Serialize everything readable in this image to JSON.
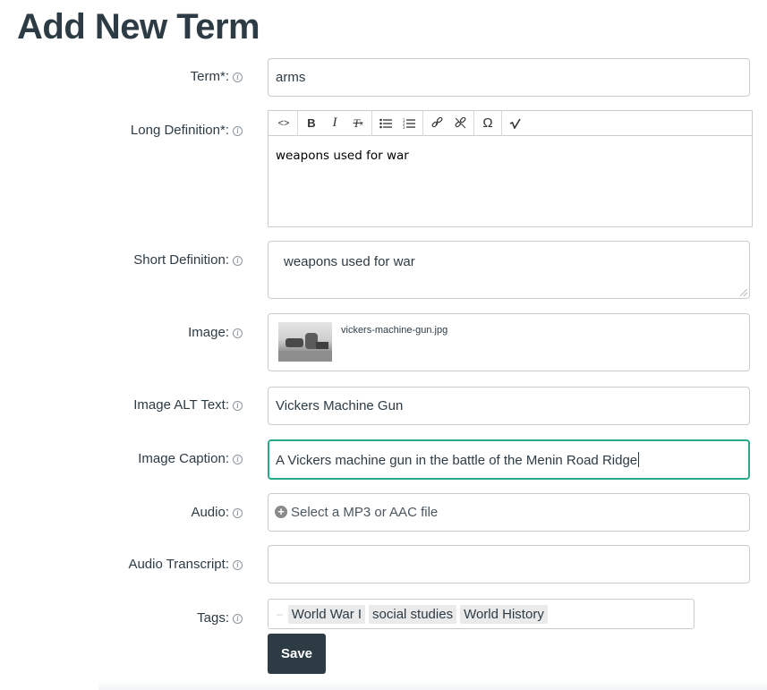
{
  "page": {
    "title": "Add New Term"
  },
  "fields": {
    "term": {
      "label": "Term*:",
      "value": "arms"
    },
    "long_definition": {
      "label": "Long Definition*:",
      "value": "weapons used for war",
      "toolbar": [
        "code-view-icon",
        "bold-icon",
        "italic-icon",
        "clear-formatting-icon",
        "bullet-list-icon",
        "numbered-list-icon",
        "link-icon",
        "unlink-icon",
        "special-character-icon",
        "math-equation-icon"
      ]
    },
    "short_definition": {
      "label": "Short Definition:",
      "value": "weapons used for war"
    },
    "image": {
      "label": "Image:",
      "filename": "vickers-machine-gun.jpg"
    },
    "image_alt": {
      "label": "Image ALT Text:",
      "value": "Vickers Machine Gun"
    },
    "image_caption": {
      "label": "Image Caption:",
      "value": "A Vickers machine gun in the battle of the Menin Road Ridge"
    },
    "audio": {
      "label": "Audio:",
      "placeholder": "Select a MP3 or AAC file"
    },
    "audio_transcript": {
      "label": "Audio Transcript:",
      "value": ""
    },
    "tags": {
      "label": "Tags:",
      "items": [
        "World War I",
        "social studies",
        "World History"
      ]
    }
  },
  "actions": {
    "save_label": "Save"
  },
  "colors": {
    "primary": "#2d3b45",
    "focus": "#2aa889",
    "border": "#c7cdd1"
  }
}
